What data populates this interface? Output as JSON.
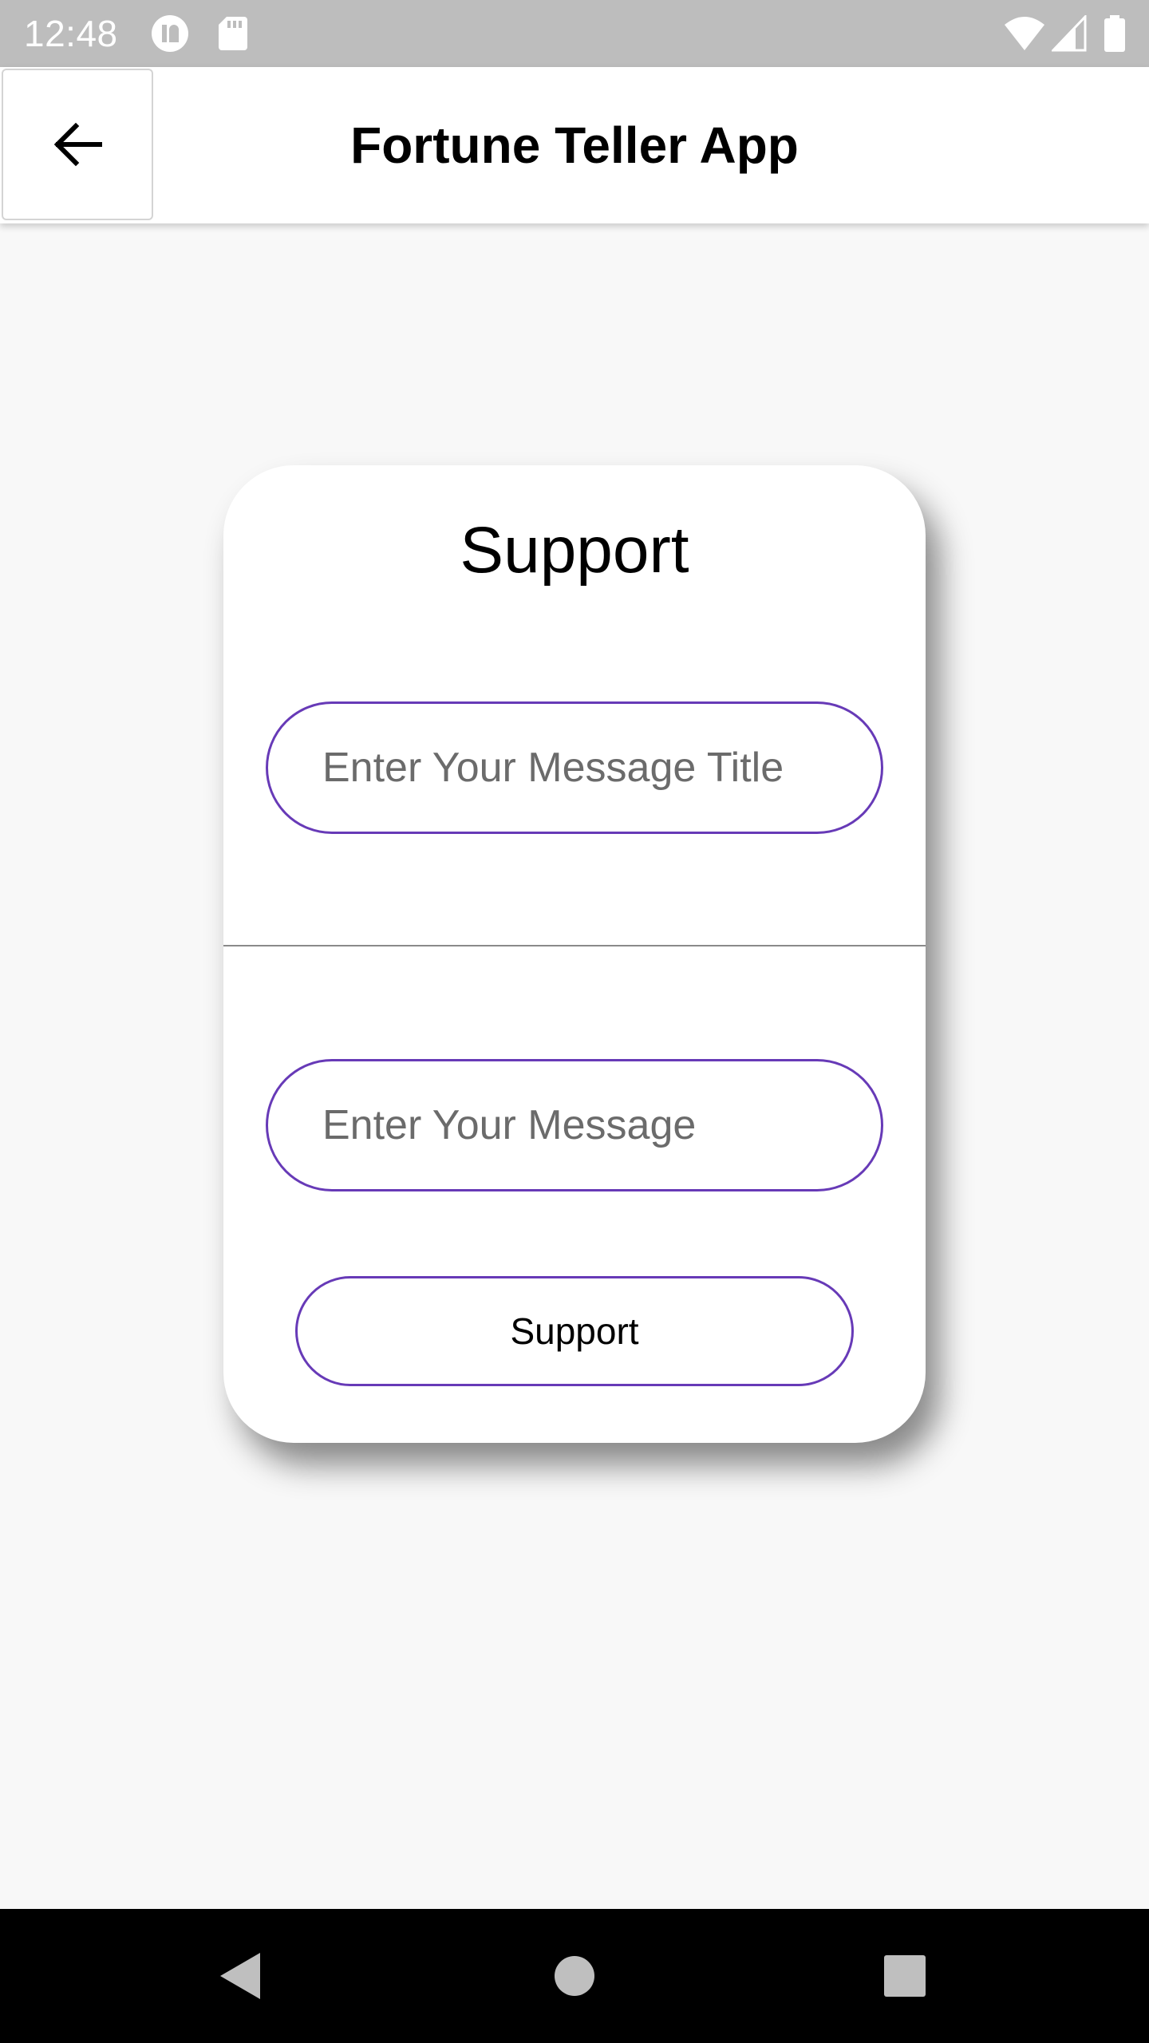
{
  "status_bar": {
    "time": "12:48",
    "left_icons": [
      "notification-icon",
      "sd-card-icon"
    ],
    "right_icons": [
      "wifi-icon",
      "cell-signal-icon",
      "battery-icon"
    ]
  },
  "app_bar": {
    "title": "Fortune Teller App",
    "back_icon": "arrow-back-icon"
  },
  "card": {
    "title": "Support",
    "title_input": {
      "value": "",
      "placeholder": "Enter Your Message Title"
    },
    "message_input": {
      "value": "",
      "placeholder": "Enter Your Message"
    },
    "submit_label": "Support"
  },
  "nav_bar": {
    "icons": [
      "nav-back-icon",
      "nav-home-icon",
      "nav-recents-icon"
    ]
  },
  "colors": {
    "accent": "#673ab7",
    "status_bar": "#bdbdbd",
    "background": "#f8f8f8",
    "nav_bar": "#000000"
  }
}
